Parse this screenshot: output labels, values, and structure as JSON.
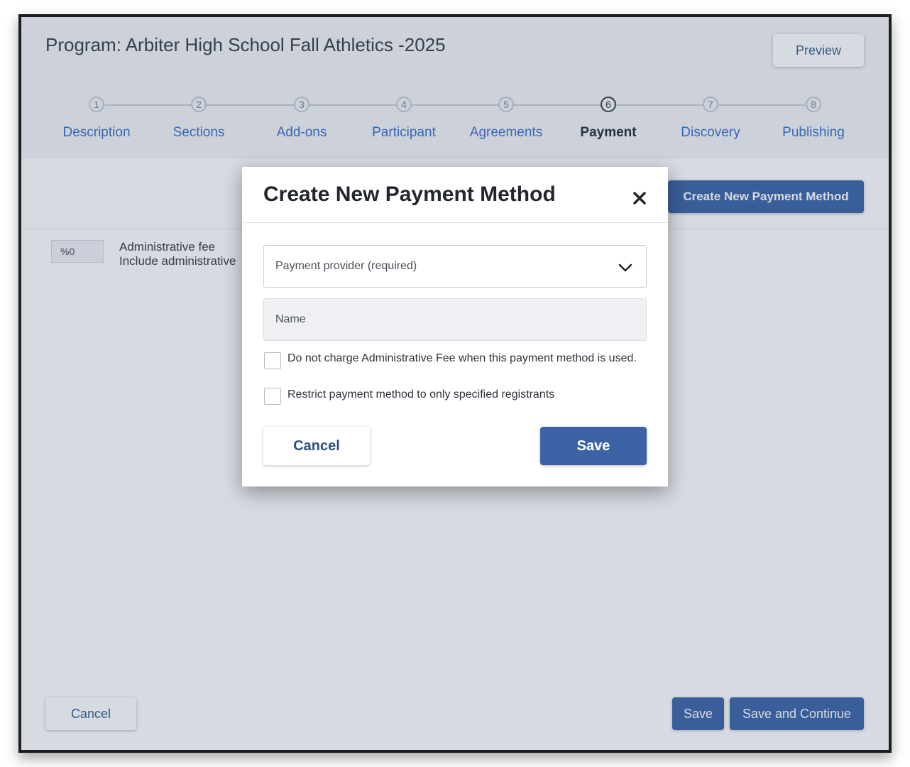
{
  "program": {
    "title": "Program: Arbiter High School Fall Athletics -2025",
    "preview_label": "Preview"
  },
  "steps": [
    {
      "num": "1",
      "label": "Description"
    },
    {
      "num": "2",
      "label": "Sections"
    },
    {
      "num": "3",
      "label": "Add-ons"
    },
    {
      "num": "4",
      "label": "Participant"
    },
    {
      "num": "5",
      "label": "Agreements"
    },
    {
      "num": "6",
      "label": "Payment",
      "active": true
    },
    {
      "num": "7",
      "label": "Discovery"
    },
    {
      "num": "8",
      "label": "Publishing"
    }
  ],
  "page": {
    "create_button": "Create New Payment Method",
    "fee_value": "%0",
    "fee_title": "Administrative fee",
    "fee_subtitle": "Include administrative"
  },
  "footer": {
    "cancel": "Cancel",
    "save": "Save",
    "save_continue": "Save and Continue"
  },
  "modal": {
    "title": "Create New Payment Method",
    "provider_placeholder": "Payment provider (required)",
    "name_placeholder": "Name",
    "checkbox1_label": "Do not charge Administrative Fee when this payment method is used.",
    "checkbox2_label": "Restrict payment method to only specified registrants",
    "cancel_label": "Cancel",
    "save_label": "Save"
  },
  "colors": {
    "accent": "#3f67a8",
    "link": "#3f72c8",
    "overlay": "#243a60"
  },
  "icons": {
    "close": "close-icon",
    "dropdown": "chevron-down-icon"
  }
}
